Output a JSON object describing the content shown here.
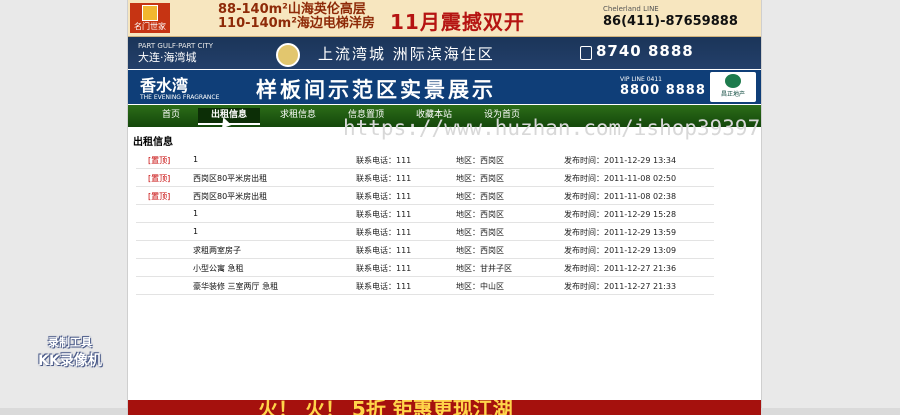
{
  "banner1": {
    "logo_text": "名门世家",
    "line1": "88-140m²山海英伦高层",
    "line2": "110-140m²海边电梯洋房",
    "promo": "11月震撼双开",
    "hotline_label": "Chelerland LINE",
    "hotline": "86(411)-87659888"
  },
  "banner2": {
    "brand_en": "PART GULF·PART CITY",
    "brand_cn": "大连·海湾城",
    "slogan": "上流湾城  洲际滨海住区",
    "tel": "8740 8888"
  },
  "banner3": {
    "brand": "香水湾",
    "brand_sub": "THE EVENING FRAGRANCE",
    "title": "样板间示范区实景展示",
    "tel_label": "VIP LINE 0411",
    "tel": "8800 8888",
    "logo_text": "昌正地产"
  },
  "nav": {
    "items": [
      {
        "label": "首页"
      },
      {
        "label": "出租信息"
      },
      {
        "label": "求租信息"
      },
      {
        "label": "信息置顶"
      },
      {
        "label": "收藏本站"
      },
      {
        "label": "设为首页"
      }
    ]
  },
  "content": {
    "title": "出租信息",
    "rows": [
      {
        "top": "[置顶]",
        "title": "1",
        "contact": "联系电话：111",
        "area": "地区：西岗区",
        "date": "发布时间：2011-12-29 13:34"
      },
      {
        "top": "[置顶]",
        "title": "西岗区80平米房出租",
        "contact": "联系电话：111",
        "area": "地区：西岗区",
        "date": "发布时间：2011-11-08 02:50"
      },
      {
        "top": "[置顶]",
        "title": "西岗区80平米房出租",
        "contact": "联系电话：111",
        "area": "地区：西岗区",
        "date": "发布时间：2011-11-08 02:38"
      },
      {
        "top": "",
        "title": "1",
        "contact": "联系电话：111",
        "area": "地区：西岗区",
        "date": "发布时间：2011-12-29 15:28"
      },
      {
        "top": "",
        "title": "1",
        "contact": "联系电话：111",
        "area": "地区：西岗区",
        "date": "发布时间：2011-12-29 13:59"
      },
      {
        "top": "",
        "title": "求租两室房子",
        "contact": "联系电话：111",
        "area": "地区：西岗区",
        "date": "发布时间：2011-12-29 13:09"
      },
      {
        "top": "",
        "title": "小型公寓 急租",
        "contact": "联系电话：111",
        "area": "地区：甘井子区",
        "date": "发布时间：2011-12-27 21:36"
      },
      {
        "top": "",
        "title": "豪华装修 三室两厅 急租",
        "contact": "联系电话：111",
        "area": "地区：中山区",
        "date": "发布时间：2011-12-27 21:33"
      }
    ]
  },
  "watermark": "https://www.huzhan.com/ishop39397",
  "bottom_banner": "火！  火！    5折  钜惠更现江湖",
  "recorder": {
    "line1": "录制工具",
    "line2": "KK录像机"
  }
}
